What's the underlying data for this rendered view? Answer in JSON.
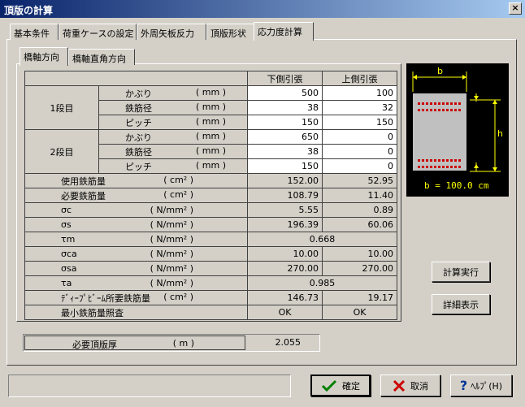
{
  "window": {
    "title": "頂版の計算",
    "close_glyph": "×"
  },
  "tabs": [
    {
      "label": "基本条件"
    },
    {
      "label": "荷重ケースの設定"
    },
    {
      "label": "外周矢板反力"
    },
    {
      "label": "頂版形状"
    },
    {
      "label": "応力度計算"
    }
  ],
  "subtabs": [
    {
      "label": "橋軸方向"
    },
    {
      "label": "橋軸直角方向"
    }
  ],
  "table": {
    "col_lower": "下側引張",
    "col_upper": "上側引張",
    "group1": {
      "label": "1段目",
      "rows": [
        {
          "name": "かぶり",
          "unit": "( mm )",
          "lower": "500",
          "upper": "100"
        },
        {
          "name": "鉄筋径",
          "unit": "( mm )",
          "lower": "38",
          "upper": "32"
        },
        {
          "name": "ピッチ",
          "unit": "( mm )",
          "lower": "150",
          "upper": "150"
        }
      ]
    },
    "group2": {
      "label": "2段目",
      "rows": [
        {
          "name": "かぶり",
          "unit": "( mm )",
          "lower": "650",
          "upper": "0"
        },
        {
          "name": "鉄筋径",
          "unit": "( mm )",
          "lower": "38",
          "upper": "0"
        },
        {
          "name": "ピッチ",
          "unit": "( mm )",
          "lower": "150",
          "upper": "0"
        }
      ]
    },
    "calc_rows": [
      {
        "name": "使用鉄筋量",
        "unit": "( cm² )",
        "lower": "152.00",
        "upper": "52.95"
      },
      {
        "name": "必要鉄筋量",
        "unit": "( cm² )",
        "lower": "108.79",
        "upper": "11.40"
      },
      {
        "name": "σc",
        "unit": "( N/mm² )",
        "lower": "5.55",
        "upper": "0.89"
      },
      {
        "name": "σs",
        "unit": "( N/mm² )",
        "lower": "196.39",
        "upper": "60.06"
      },
      {
        "name": "τm",
        "unit": "( N/mm² )",
        "merged": "0.668"
      },
      {
        "name": "σca",
        "unit": "( N/mm² )",
        "lower": "10.00",
        "upper": "10.00"
      },
      {
        "name": "σsa",
        "unit": "( N/mm² )",
        "lower": "270.00",
        "upper": "270.00"
      },
      {
        "name": "τa",
        "unit": "( N/mm² )",
        "merged": "0.985"
      },
      {
        "name": "ﾃﾞｨｰﾌﾟﾋﾞｰﾑ所要鉄筋量",
        "unit": "( cm² )",
        "lower": "146.73",
        "upper": "19.17"
      },
      {
        "name": "最小鉄筋量照査",
        "unit": "",
        "lower": "OK",
        "upper": "OK",
        "center": true
      }
    ]
  },
  "diagram": {
    "b_label": "b",
    "h_label": "h",
    "caption": "b = 100.0 cm",
    "accent": "#ffff00",
    "rebar_color": "#cc0000"
  },
  "thickness": {
    "label": "必要頂版厚",
    "unit": "( m )",
    "value": "2.055"
  },
  "buttons": {
    "calc": "計算実行",
    "detail": "詳細表示",
    "ok": "確定",
    "cancel": "取消",
    "help": "ﾍﾙﾌﾟ(H)"
  }
}
